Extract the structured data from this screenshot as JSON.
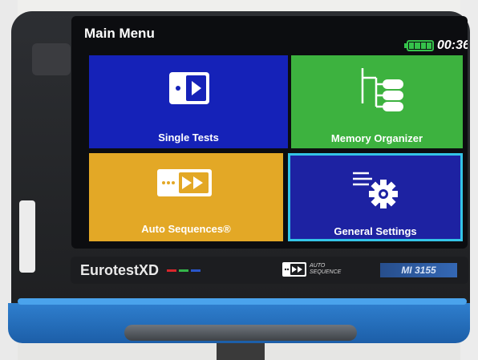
{
  "screen": {
    "title": "Main Menu",
    "clock": "00:36",
    "battery": {
      "level_percent": 100,
      "color": "#35c24b"
    }
  },
  "tiles": [
    {
      "label": "Single Tests",
      "color": "#1522b8",
      "icon": "single-test-play-icon"
    },
    {
      "label": "Memory Organizer",
      "color": "#3db23f",
      "icon": "memory-tree-icon"
    },
    {
      "label": "Auto Sequences®",
      "color": "#e3a826",
      "icon": "auto-sequence-icon"
    },
    {
      "label": "General Settings",
      "color": "#1d22a2",
      "icon": "settings-gear-icon",
      "selected": true
    }
  ],
  "device": {
    "brand": "EurotestXD",
    "brand_dash_colors": [
      "#d8262b",
      "#34b54a",
      "#2a56c9"
    ],
    "sequence_logo": [
      "AUTO",
      "SEQUENCE"
    ],
    "model": "MI 3155"
  }
}
